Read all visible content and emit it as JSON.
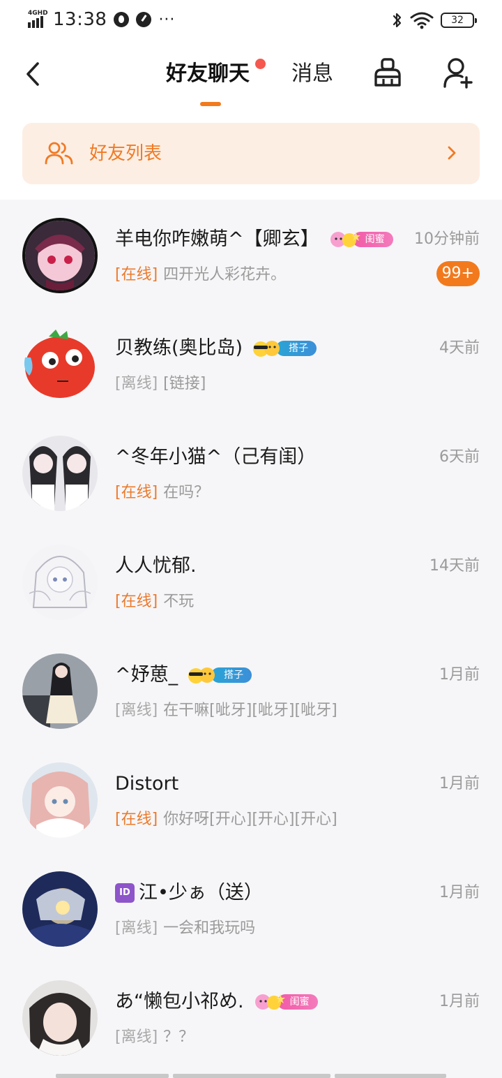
{
  "status_bar": {
    "network": "4GHD",
    "time": "13:38",
    "more": "···",
    "battery": "32"
  },
  "header": {
    "tabs": [
      {
        "label": "好友聊天",
        "active": true,
        "has_dot": true
      },
      {
        "label": "消息",
        "active": false
      }
    ],
    "icons": [
      "back-icon",
      "broom-icon",
      "add-friend-icon"
    ]
  },
  "friend_list_banner": {
    "label": "好友列表",
    "icon": "friends-icon",
    "chevron": "chevron-right-icon"
  },
  "colors": {
    "accent": "#f27a1d",
    "online": "#ec7a2c",
    "offline": "#a8a8a8",
    "tag_pink": "#f25aa7",
    "tag_blue": "#2aa4d6"
  },
  "chats": [
    {
      "name": "羊电你咋嫩萌^【卿玄】",
      "badge": {
        "label": "闺蜜",
        "type": "pink"
      },
      "time": "10分钟前",
      "status": "[在线]",
      "online": true,
      "preview": "四开光人彩花卉。",
      "unread": "99+"
    },
    {
      "name": "贝教练(奥比岛)",
      "badge": {
        "label": "搭子",
        "type": "blue"
      },
      "time": "4天前",
      "status": "[离线]",
      "online": false,
      "preview": "[链接]"
    },
    {
      "name": "^冬年小猫^（己有闺）",
      "time": "6天前",
      "status": "[在线]",
      "online": true,
      "preview": "在吗？"
    },
    {
      "name": "人人忧郁.",
      "time": "14天前",
      "status": "[在线]",
      "online": true,
      "preview": "不玩"
    },
    {
      "name": "^妤葸_",
      "badge": {
        "label": "搭子",
        "type": "blue"
      },
      "time": "1月前",
      "status": "[离线]",
      "online": false,
      "preview": "在干嘛[呲牙][呲牙][呲牙]"
    },
    {
      "name": "Distort",
      "time": "1月前",
      "status": "[在线]",
      "online": true,
      "preview": "你好呀[开心][开心][开心]"
    },
    {
      "name": "江•少ぁ（送）",
      "id_icon": "ID",
      "time": "1月前",
      "status": "[离线]",
      "online": false,
      "preview": "一会和我玩吗"
    },
    {
      "name": "あ“懒包小祁め.",
      "badge": {
        "label": "闺蜜",
        "type": "pink"
      },
      "time": "1月前",
      "status": "[离线]",
      "online": false,
      "preview": "？？"
    }
  ]
}
